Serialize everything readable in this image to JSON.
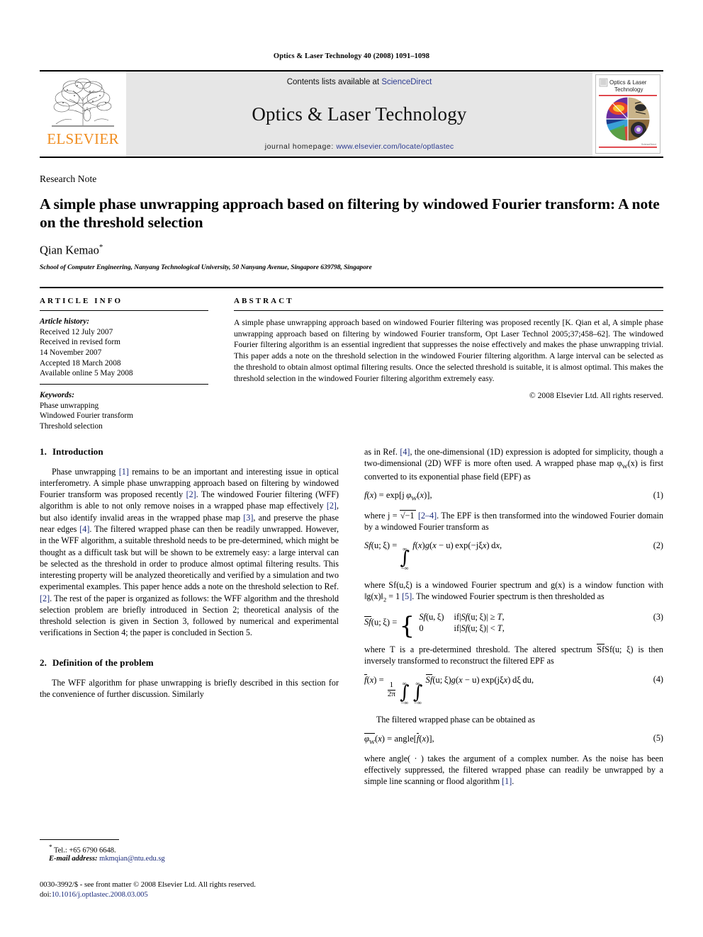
{
  "running_head": "Optics & Laser Technology 40 (2008) 1091–1098",
  "masthead": {
    "publisher_name": "ELSEVIER",
    "contents_prefix": "Contents lists available at ",
    "contents_link": "ScienceDirect",
    "journal_name": "Optics & Laser Technology",
    "homepage_prefix": "journal homepage: ",
    "homepage_url": "www.elsevier.com/locate/optlastec",
    "cover_title_line1": "Optics & Laser",
    "cover_title_line2": "Technology"
  },
  "title_block": {
    "doctype": "Research Note",
    "title": "A simple phase unwrapping approach based on filtering by windowed Fourier transform: A note on the threshold selection",
    "author": "Qian Kemao",
    "author_marker": "*",
    "affiliation": "School of Computer Engineering, Nanyang Technological University, 50 Nanyang Avenue, Singapore 639798, Singapore"
  },
  "article_info": {
    "heading": "ARTICLE INFO",
    "history_label": "Article history:",
    "history": [
      "Received 12 July 2007",
      "Received in revised form",
      "14 November 2007",
      "Accepted 18 March 2008",
      "Available online 5 May 2008"
    ],
    "keywords_label": "Keywords:",
    "keywords": [
      "Phase unwrapping",
      "Windowed Fourier transform",
      "Threshold selection"
    ]
  },
  "abstract": {
    "heading": "ABSTRACT",
    "text": "A simple phase unwrapping approach based on windowed Fourier filtering was proposed recently [K. Qian et al, A simple phase unwrapping approach based on filtering by windowed Fourier transform, Opt Laser Technol 2005;37;458–62]. The windowed Fourier filtering algorithm is an essential ingredient that suppresses the noise effectively and makes the phase unwrapping trivial. This paper adds a note on the threshold selection in the windowed Fourier filtering algorithm. A large interval can be selected as the threshold to obtain almost optimal filtering results. Once the selected threshold is suitable, it is almost optimal. This makes the threshold selection in the windowed Fourier filtering algorithm extremely easy.",
    "copyright": "© 2008 Elsevier Ltd. All rights reserved."
  },
  "sections": {
    "intro": {
      "number": "1.",
      "title": "Introduction",
      "p1_a": "Phase unwrapping ",
      "p1_c1": "[1]",
      "p1_b": " remains to be an important and interesting issue in optical interferometry. A simple phase unwrapping approach based on filtering by windowed Fourier transform was proposed recently ",
      "p1_c2": "[2]",
      "p1_c": ". The windowed Fourier filtering (WFF) algorithm is able to not only remove noises in a wrapped phase map effectively ",
      "p1_c3": "[2]",
      "p1_d": ", but also identify invalid areas in the wrapped phase map ",
      "p1_c4": "[3]",
      "p1_e": ", and preserve the phase near edges ",
      "p1_c5": "[4]",
      "p1_f": ". The filtered wrapped phase can then be readily unwrapped. However, in the WFF algorithm, a suitable threshold needs to be pre-determined, which might be thought as a difficult task but will be shown to be extremely easy: a large interval can be selected as the threshold in order to produce almost optimal filtering results. This interesting property will be analyzed theoretically and verified by a simulation and two experimental examples. This paper hence adds a note on the threshold selection to Ref. ",
      "p1_c6": "[2]",
      "p1_g": ". The rest of the paper is organized as follows: the WFF algorithm and the threshold selection problem are briefly introduced in Section 2; theoretical analysis of the threshold selection is given in Section 3, followed by numerical and experimental verifications in Section 4; the paper is concluded in Section 5."
    },
    "definition": {
      "number": "2.",
      "title": "Definition of the problem",
      "p1": "The WFF algorithm for phase unwrapping is briefly described in this section for the convenience of further discussion. Similarly"
    }
  },
  "right_column": {
    "p1_a": "as in Ref. ",
    "p1_c1": "[4]",
    "p1_b": ", the one-dimensional (1D) expression is adopted for simplicity, though a two-dimensional (2D) WFF is more often used. A wrapped phase map φ",
    "p1_sub": "W",
    "p1_c": "(x) is first converted to its exponential phase field (EPF) as",
    "eq1_num": "(1)",
    "p2_a": "where j = ",
    "p2_sqrt": "√−1",
    "p2_b": " ",
    "p2_c1": "[2–4]",
    "p2_c": ". The EPF is then transformed into the windowed Fourier domain by a windowed Fourier transform as",
    "eq2_num": "(2)",
    "p3_a": "where Sf(u,ξ) is a windowed Fourier spectrum and g(x) is a window function with ‖g(x)‖",
    "p3_sub": "2",
    "p3_b": " = 1 ",
    "p3_c1": "[5]",
    "p3_c": ". The windowed Fourier spectrum is then thresholded as",
    "eq3_num": "(3)",
    "p4_a": "where T is a pre-determined threshold. The altered spectrum ",
    "p4_b": "Sf(u; ξ) is then inversely transformed to reconstruct the filtered EPF as",
    "eq4_num": "(4)",
    "p5": "The filtered wrapped phase can be obtained as",
    "eq5_num": "(5)",
    "p6_a": "where angle( · ) takes the argument of a complex number. As the noise has been effectively suppressed, the filtered wrapped phase can readily be unwrapped by a simple line scanning or flood algorithm ",
    "p6_c1": "[1]",
    "p6_b": "."
  },
  "footnote": {
    "marker": "*",
    "tel": "Tel.: +65 6790 6648.",
    "email_label": "E-mail address:",
    "email": "mkmqian@ntu.edu.sg"
  },
  "imprint": {
    "line1": "0030-3992/$ - see front matter © 2008 Elsevier Ltd. All rights reserved.",
    "doi_label": "doi:",
    "doi": "10.1016/j.optlastec.2008.03.005"
  },
  "colors": {
    "link": "#1a2a7a",
    "elsevier_orange": "#F08C1E",
    "banner_bg": "#e6e6e6"
  }
}
